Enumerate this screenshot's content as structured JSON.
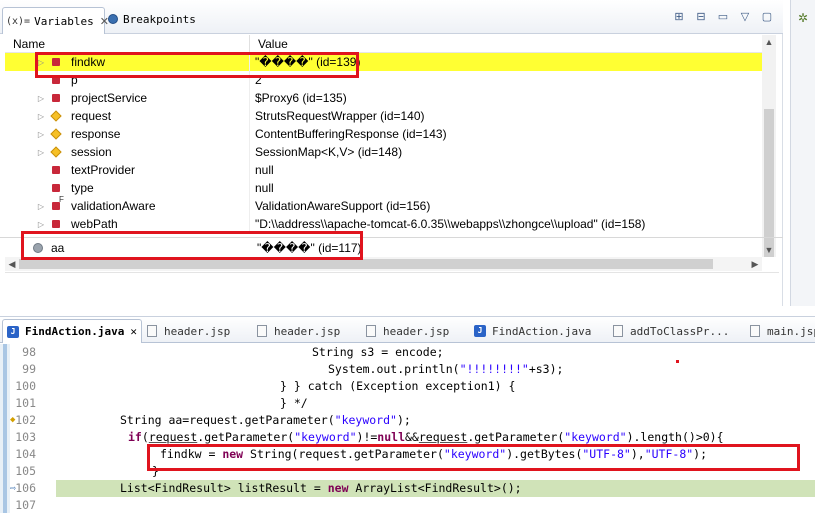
{
  "variables_view": {
    "tabs": [
      {
        "label": "Variables",
        "prefix": "(x)=",
        "close": "✕"
      },
      {
        "label": "Breakpoints"
      }
    ],
    "toolbar_icons": [
      "show-type-names-icon",
      "collapse-all-icon",
      "view-menu-icon",
      "minimize-icon",
      "maximize-icon"
    ],
    "columns": {
      "name": "Name",
      "value": "Value"
    },
    "rows": [
      {
        "name": "findkw",
        "value": "\"����\" (id=139)",
        "icon": "field-private",
        "expandable": true,
        "selected": true
      },
      {
        "name": "p",
        "value": "2",
        "icon": "field-private",
        "expandable": false
      },
      {
        "name": "projectService",
        "value": "$Proxy6  (id=135)",
        "icon": "field-private",
        "expandable": true
      },
      {
        "name": "request",
        "value": "StrutsRequestWrapper  (id=140)",
        "icon": "field-protected",
        "expandable": true
      },
      {
        "name": "response",
        "value": "ContentBufferingResponse  (id=143)",
        "icon": "field-protected",
        "expandable": true
      },
      {
        "name": "session",
        "value": "SessionMap<K,V>  (id=148)",
        "icon": "field-protected",
        "expandable": true
      },
      {
        "name": "textProvider",
        "value": "null",
        "icon": "field-private",
        "expandable": false
      },
      {
        "name": "type",
        "value": "null",
        "icon": "field-private",
        "expandable": false
      },
      {
        "name": "validationAware",
        "value": "ValidationAwareSupport  (id=156)",
        "icon": "field-private-final",
        "expandable": true
      },
      {
        "name": "webPath",
        "value": "\"D:\\\\address\\\\apache-tomcat-6.0.35\\\\webapps\\\\zhongce\\\\upload\" (id=158)",
        "icon": "field-private",
        "expandable": true
      }
    ],
    "local_row": {
      "name": "aa",
      "value": "\"����\" (id=117)"
    }
  },
  "editor": {
    "tabs": [
      {
        "label": "FindAction.java",
        "active": true,
        "icon": "java"
      },
      {
        "label": "header.jsp",
        "icon": "file"
      },
      {
        "label": "header.jsp",
        "icon": "file"
      },
      {
        "label": "header.jsp",
        "icon": "file"
      },
      {
        "label": "FindAction.java",
        "icon": "java"
      },
      {
        "label": "addToClassPr...",
        "icon": "file"
      },
      {
        "label": "main.jsp",
        "icon": "file"
      }
    ],
    "lines": [
      {
        "n": "98"
      },
      {
        "n": "99"
      },
      {
        "n": "100"
      },
      {
        "n": "101"
      },
      {
        "n": "102"
      },
      {
        "n": "103"
      },
      {
        "n": "104"
      },
      {
        "n": "105"
      },
      {
        "n": "106"
      },
      {
        "n": "107"
      }
    ],
    "code": {
      "l98": {
        "a": "String s3 = encode;"
      },
      "l99": {
        "a": "System.out.println(",
        "s": "\"!!!!!!!!\"",
        "b": "+s3);"
      },
      "l100": {
        "a": "} } catch (Exception exception1) {"
      },
      "l101": {
        "a": "} */"
      },
      "l102": {
        "a": "String aa=request.getParameter(",
        "s": "\"keyword\"",
        "b": ");"
      },
      "l103": {
        "kw_if": "if",
        "a": "(",
        "u1": "request",
        "b": ".getParameter(",
        "s1": "\"keyword\"",
        "c": ")!=",
        "kw_null": "null",
        "d": "&&",
        "u2": "request",
        "e": ".getParameter(",
        "s2": "\"keyword\"",
        "f": ").length()>0){"
      },
      "l104": {
        "a": "findkw = ",
        "kw_new": "new",
        "b": " String(request.getParameter(",
        "s1": "\"keyword\"",
        "c": ").getBytes(",
        "s2": "\"UTF-8\"",
        "d": "),",
        "s3": "\"UTF-8\"",
        "e": ");"
      },
      "l105": {
        "a": "}"
      },
      "l106": {
        "a": "List<FindResult> listResult = ",
        "kw_new": "new",
        "b": " ArrayList<FindResult>();"
      }
    }
  },
  "colors": {
    "selection_highlight": "#ffff33",
    "annotation_red": "#e0141e",
    "current_line": "#d0e3b8",
    "string": "#2a00ff",
    "keyword": "#7f0055"
  }
}
